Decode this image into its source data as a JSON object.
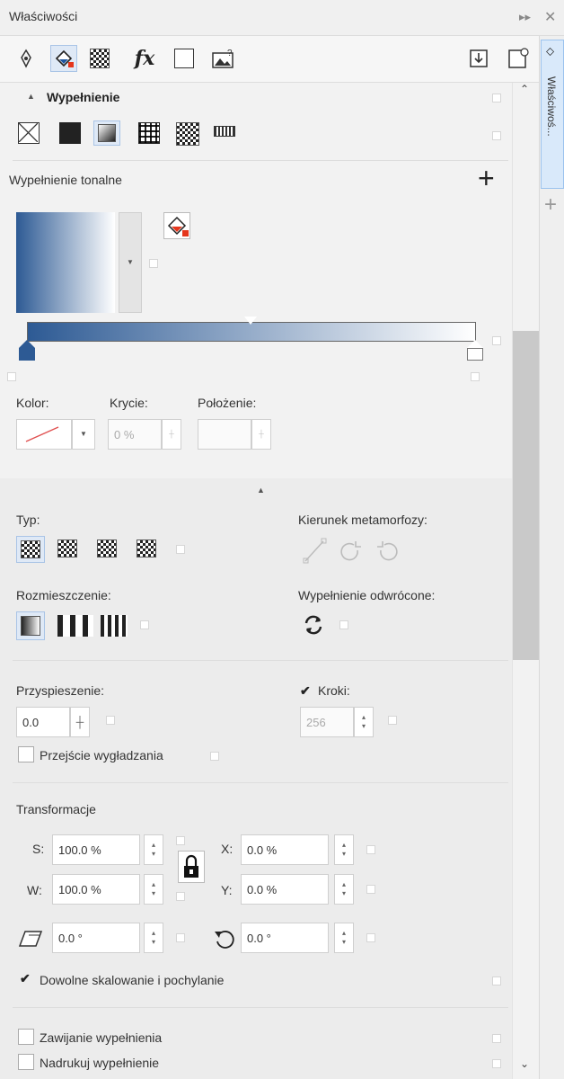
{
  "window": {
    "title": "Właściwości",
    "side_tab_label": "Właściwoś..."
  },
  "section": {
    "title": "Wypełnienie"
  },
  "fill_type_label": "Wypełnienie tonalne",
  "color_row": {
    "kolor": "Kolor:",
    "krycie": "Krycie:",
    "polozenie": "Położenie:",
    "krycie_value": "0 %"
  },
  "type_section": {
    "typ": "Typ:",
    "kierunek": "Kierunek metamorfozy:",
    "rozmieszczenie": "Rozmieszczenie:",
    "odwrocone": "Wypełnienie odwrócone:"
  },
  "accel": {
    "label": "Przyspieszenie:",
    "value": "0.0",
    "steps_label": "Kroki:",
    "steps_value": "256",
    "smooth_label": "Przejście wygładzania"
  },
  "transform": {
    "title": "Transformacje",
    "s_label": "S:",
    "s_value": "100.0 %",
    "w_label": "W:",
    "w_value": "100.0 %",
    "x_label": "X:",
    "x_value": "0.0 %",
    "y_label": "Y:",
    "y_value": "0.0 %",
    "skew_value": "0.0 °",
    "rotate_value": "0.0 °",
    "free_scale": "Dowolne skalowanie i pochylanie"
  },
  "bottom": {
    "wrap": "Zawijanie wypełnienia",
    "overprint": "Nadrukuj wypełnienie"
  },
  "colors": {
    "gradient_start": "#2d5a94",
    "gradient_end": "#ffffff",
    "accent_blue": "#9cc3ee",
    "check": "#111111"
  }
}
